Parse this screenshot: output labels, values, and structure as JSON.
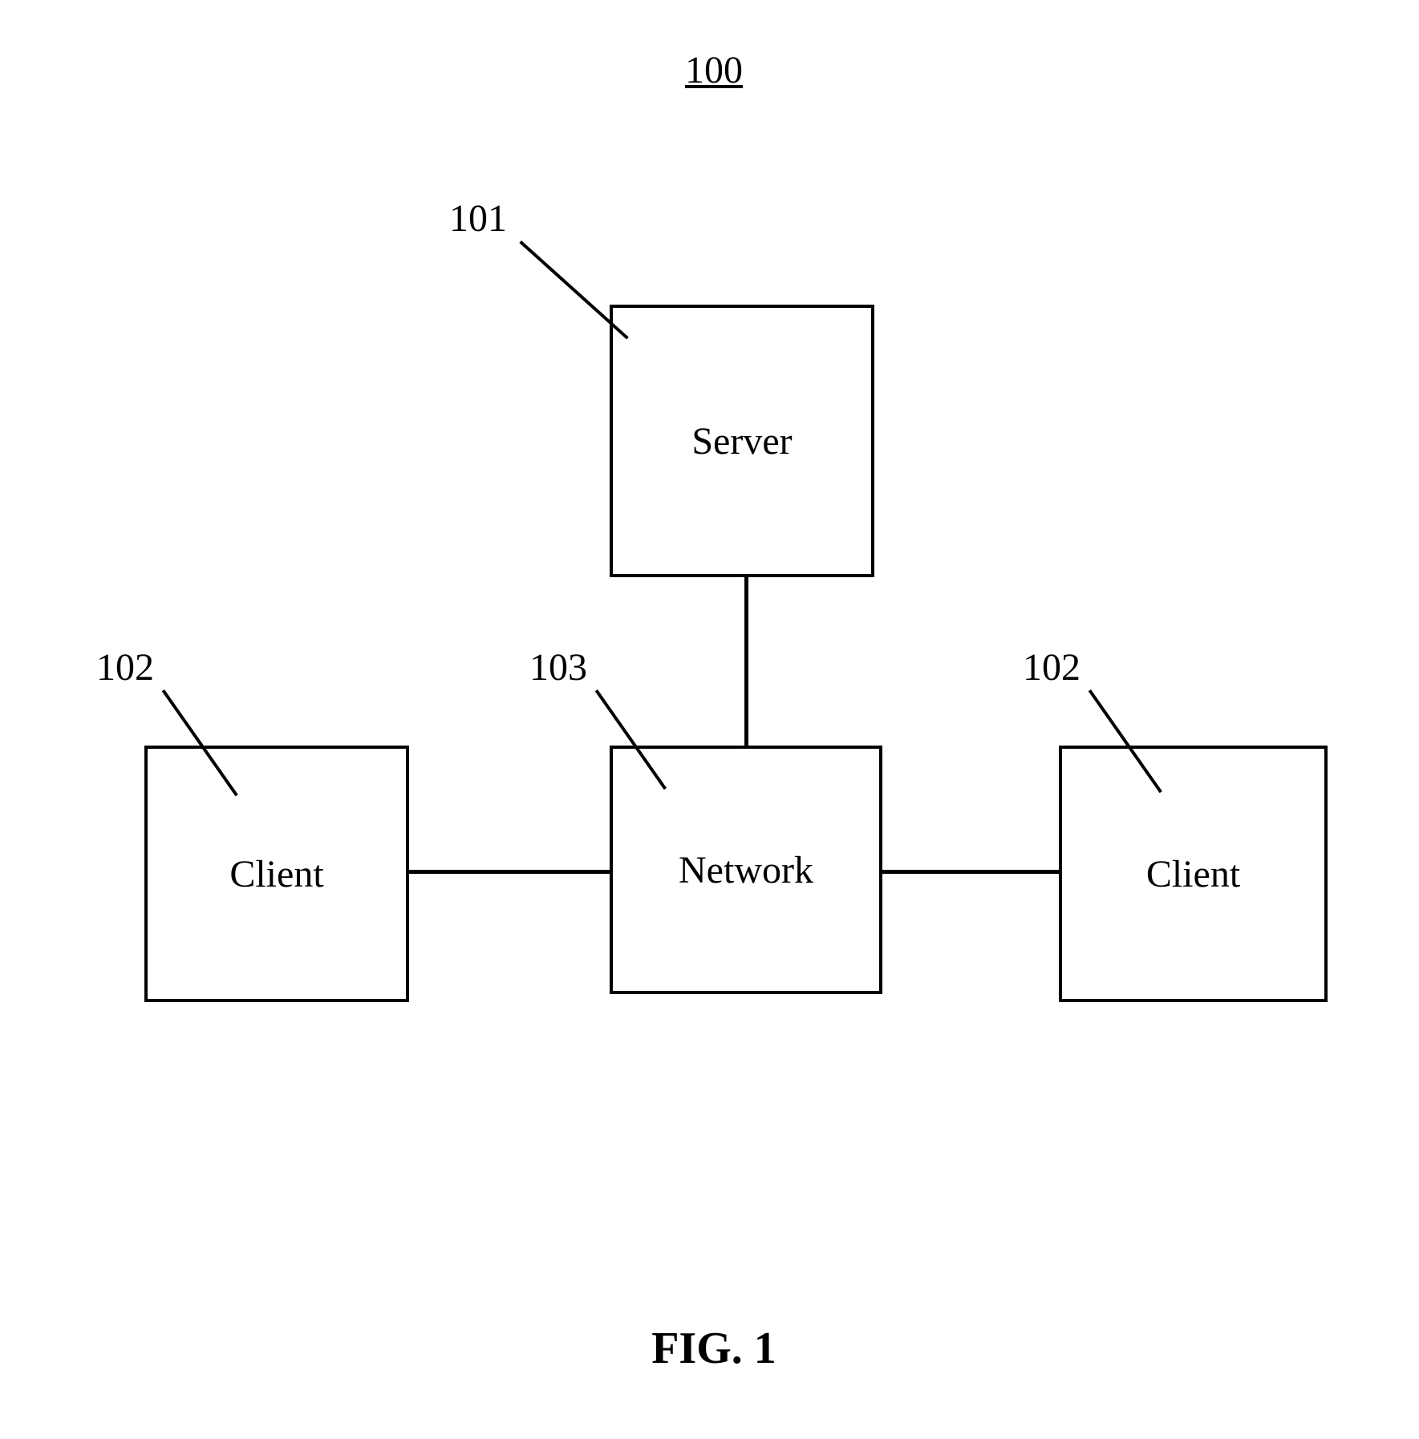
{
  "figure": {
    "number": "100",
    "caption": "FIG. 1"
  },
  "nodes": {
    "server": {
      "label": "Server",
      "ref": "101"
    },
    "network": {
      "label": "Network",
      "ref": "103"
    },
    "client_left": {
      "label": "Client",
      "ref": "102"
    },
    "client_right": {
      "label": "Client",
      "ref": "102"
    }
  }
}
